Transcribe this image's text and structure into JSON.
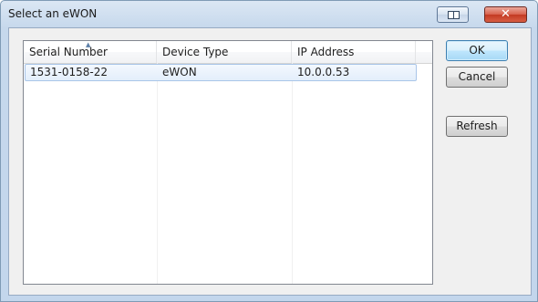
{
  "window": {
    "title": "Select an eWON",
    "help_icon": "context-help-icon",
    "close_icon": "close-icon",
    "close_glyph": "✕"
  },
  "list": {
    "columns": [
      "Serial Number",
      "Device Type",
      "IP Address"
    ],
    "sorted_column": "Serial Number",
    "sort_direction": "ascending",
    "rows": [
      {
        "serial": "1531-0158-22",
        "type": "eWON",
        "ip": "10.0.0.53",
        "selected": true
      }
    ]
  },
  "buttons": {
    "ok": "OK",
    "cancel": "Cancel",
    "refresh": "Refresh"
  },
  "colors": {
    "title_bar": "#c6d8ec",
    "close_button": "#c33a23",
    "selection_border": "#a9c5e8",
    "default_button_border": "#3c7fb1"
  }
}
